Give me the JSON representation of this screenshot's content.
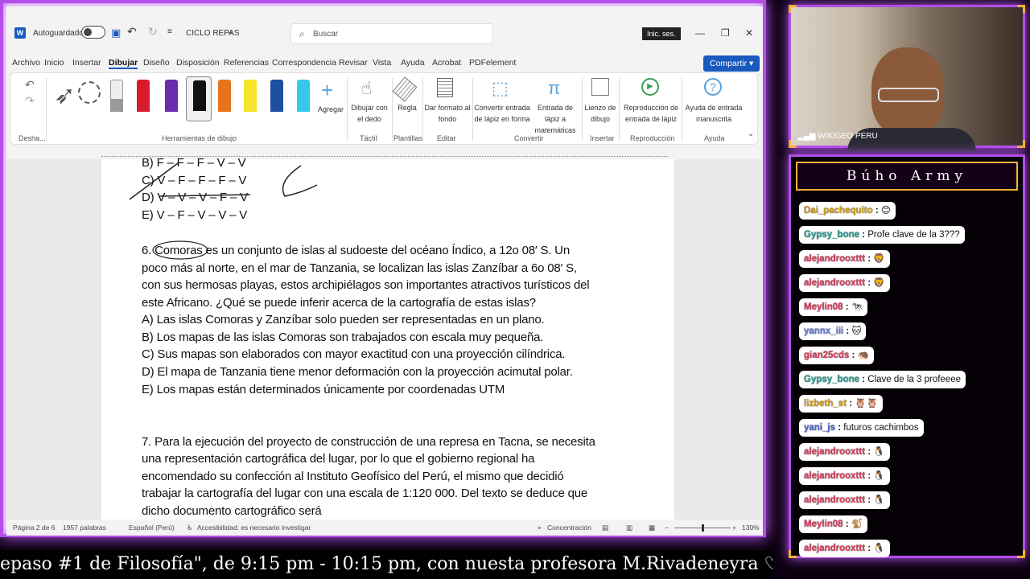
{
  "word": {
    "autosave_label": "Autoguardado",
    "doc_name": "CICLO REPAS",
    "search_placeholder": "Buscar",
    "signin": "Inic. ses.",
    "menus": [
      "Archivo",
      "Inicio",
      "Insertar",
      "Dibujar",
      "Diseño",
      "Disposición",
      "Referencias",
      "Correspondencia",
      "Revisar",
      "Vista",
      "Ayuda",
      "Acrobat",
      "PDFelement"
    ],
    "share": "Compartir",
    "ribbon": {
      "add": "Agregar",
      "draw_finger": "Dibujar con el dedo",
      "ruler": "Regla",
      "bg_format": "Dar formato al fondo",
      "ink_shape": "Convertir entrada de lápiz en forma",
      "ink_math": "Entrada de lápiz a matemáticas",
      "canvas": "Lienzo de dibujo",
      "replay": "Reproducción de entrada de lápiz",
      "ink_help": "Ayuda de entrada manuscrita",
      "groups": {
        "undo": "Desha...",
        "tools": "Herramientas de dibujo",
        "touch": "Táctil",
        "templates": "Plantillas",
        "edit": "Editar",
        "convert": "Convertir",
        "insert": "Insertar",
        "playback": "Reproducción",
        "help": "Ayuda"
      }
    },
    "doc": {
      "opt_b": "B) F – F – F – V – V",
      "opt_c": "C) V – F – F – F – V",
      "opt_d": "D) V – V – V – F – V",
      "opt_e": "E) V – F – V – V – V",
      "q6_l1": "6. Comoras es un conjunto de islas al sudoeste del océano Índico, a 12o 08′ S. Un",
      "q6_l2": "poco más al norte, en el mar de Tanzania, se localizan las islas Zanzíbar a 6o 08′ S,",
      "q6_l3": "con sus hermosas playas, estos archipiélagos son importantes atractivos turísticos del",
      "q6_l4": "este Africano. ¿Qué se puede inferir acerca de la cartografía de estas islas?",
      "q6_a": "A) Las islas Comoras y Zanzíbar solo pueden ser representadas en un plano.",
      "q6_b": "B) Los mapas de las islas Comoras son trabajados con escala muy pequeña.",
      "q6_c": "C) Sus mapas son elaborados con mayor exactitud con una proyección cilíndrica.",
      "q6_d": "D) El mapa de Tanzania tiene menor deformación con la proyección acimutal polar.",
      "q6_e": "E) Los mapas están determinados únicamente por coordenadas UTM",
      "q7_l1": "7. Para la ejecución del proyecto de construcción de una represa en Tacna, se necesita",
      "q7_l2": "una representación cartográfica del lugar, por lo que el gobierno regional ha",
      "q7_l3": "encomendado su confección al Instituto Geofísico del Perú, el mismo que decidió",
      "q7_l4": "trabajar la cartografía del lugar con una escala de 1:120 000. Del texto se deduce que",
      "q7_l5": "dicho documento cartográfico será"
    },
    "status": {
      "page": "Página 2 de 6",
      "words": "1957 palabras",
      "lang": "Español (Perú)",
      "access": "Accesibilidad: es necesario investigar",
      "focus": "Concentración",
      "zoom": "130%"
    }
  },
  "cam": {
    "label": "WIKIGEO PERU"
  },
  "chat": {
    "title": "Búho Army",
    "messages": [
      {
        "user": "Dai_pachequito",
        "color": "#d4a017",
        "text": "",
        "emoji": "😊"
      },
      {
        "user": "Gypsy_bone",
        "color": "#2aa198",
        "text": "Profe clave de la 3???",
        "emoji": ""
      },
      {
        "user": "alejandrooxttt",
        "color": "#e0405f",
        "text": "",
        "emoji": "🦁"
      },
      {
        "user": "alejandrooxttt",
        "color": "#e0405f",
        "text": "",
        "emoji": "🦁"
      },
      {
        "user": "Meylin08",
        "color": "#e0405f",
        "text": "",
        "emoji": "🐄"
      },
      {
        "user": "yannx_iii",
        "color": "#6b7fd7",
        "text": "",
        "emoji": "🐱"
      },
      {
        "user": "gian25cds",
        "color": "#e0405f",
        "text": "",
        "emoji": "🦔"
      },
      {
        "user": "Gypsy_bone",
        "color": "#2aa198",
        "text": "Clave de la 3 profeeee",
        "emoji": ""
      },
      {
        "user": "lizbeth_st",
        "color": "#d4a017",
        "text": "",
        "emoji": "🦉🦉"
      },
      {
        "user": "yani_js",
        "color": "#4f6bd8",
        "text": "futuros cachimbos",
        "emoji": ""
      },
      {
        "user": "alejandrooxttt",
        "color": "#e0405f",
        "text": "",
        "emoji": "🐧"
      },
      {
        "user": "alejandrooxttt",
        "color": "#e0405f",
        "text": "",
        "emoji": "🐧"
      },
      {
        "user": "alejandrooxttt",
        "color": "#e0405f",
        "text": "",
        "emoji": "🐧"
      },
      {
        "user": "Meylin08",
        "color": "#e0405f",
        "text": "",
        "emoji": "🐒"
      },
      {
        "user": "alejandrooxttt",
        "color": "#e0405f",
        "text": "",
        "emoji": "🐧"
      }
    ]
  },
  "banner": "epaso #1 de Filosofía\", de 9:15 pm - 10:15 pm, con nuesta profesora M.Rivadeneyra ♡",
  "colors": {
    "neon": "#b44ee8",
    "gold": "#f2b233",
    "word_blue": "#185abd"
  }
}
